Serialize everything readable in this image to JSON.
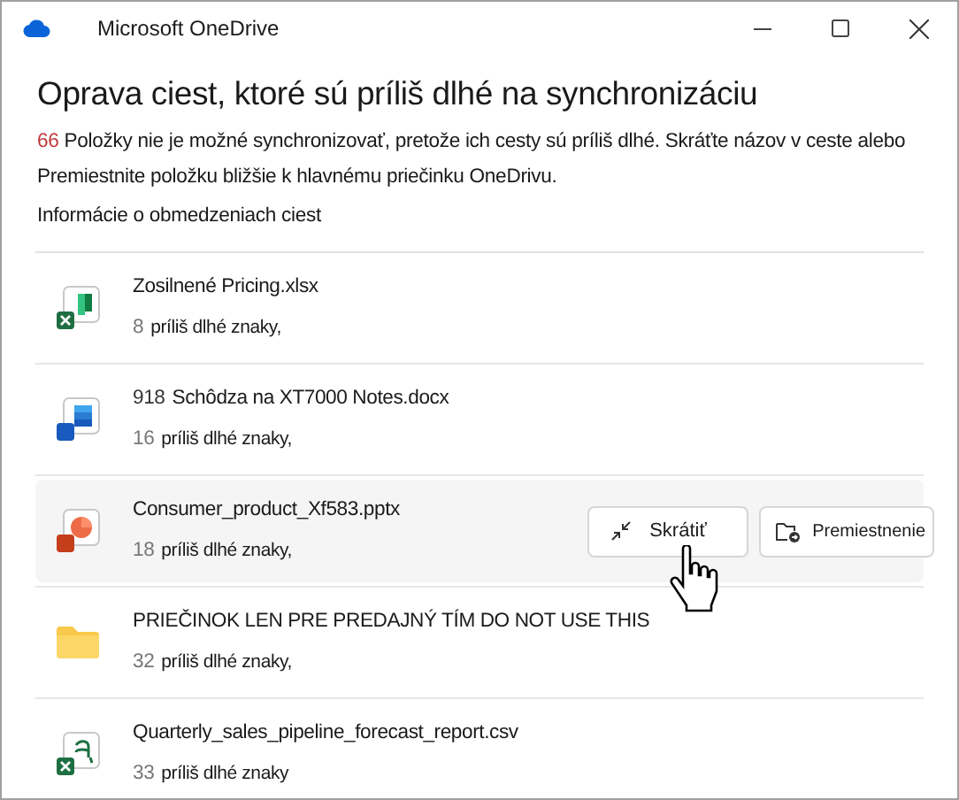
{
  "window": {
    "title": "Microsoft OneDrive"
  },
  "heading": "Oprava ciest, ktoré sú príliš dlhé na synchronizáciu",
  "summary": {
    "count": "66",
    "text": "Položky nie je možné synchronizovať, pretože ich cesty sú príliš dlhé. Skráťte názov v ceste alebo Premiestnite položku bližšie k hlavnému priečinku OneDrivu."
  },
  "info_link": "Informácie o obmedzeniach ciest",
  "items": [
    {
      "kind": "excel",
      "name": "Zosilnené Pricing.xlsx",
      "count": "8",
      "detail": "príliš dlhé znaky,",
      "selected": false
    },
    {
      "kind": "word",
      "prefix": "918",
      "name": "Schôdza na XT7000 Notes.docx",
      "count": "16",
      "detail": "príliš dlhé znaky,",
      "selected": false
    },
    {
      "kind": "powerpoint",
      "name": "Consumer_product_Xf583.pptx",
      "count": "18",
      "detail": "príliš dlhé znaky,",
      "selected": true
    },
    {
      "kind": "folder",
      "name": "PRIEČINOK LEN PRE PREDAJNÝ TÍM DO NOT USE THIS",
      "count": "32",
      "detail": "príliš dlhé znaky,",
      "selected": false
    },
    {
      "kind": "csv",
      "name": "Quarterly_sales_pipeline_forecast_report.csv",
      "count": "33",
      "detail": "príliš dlhé znaky",
      "selected": false
    }
  ],
  "actions": {
    "shorten": "Skrátiť",
    "move": "Premiestnenie"
  }
}
